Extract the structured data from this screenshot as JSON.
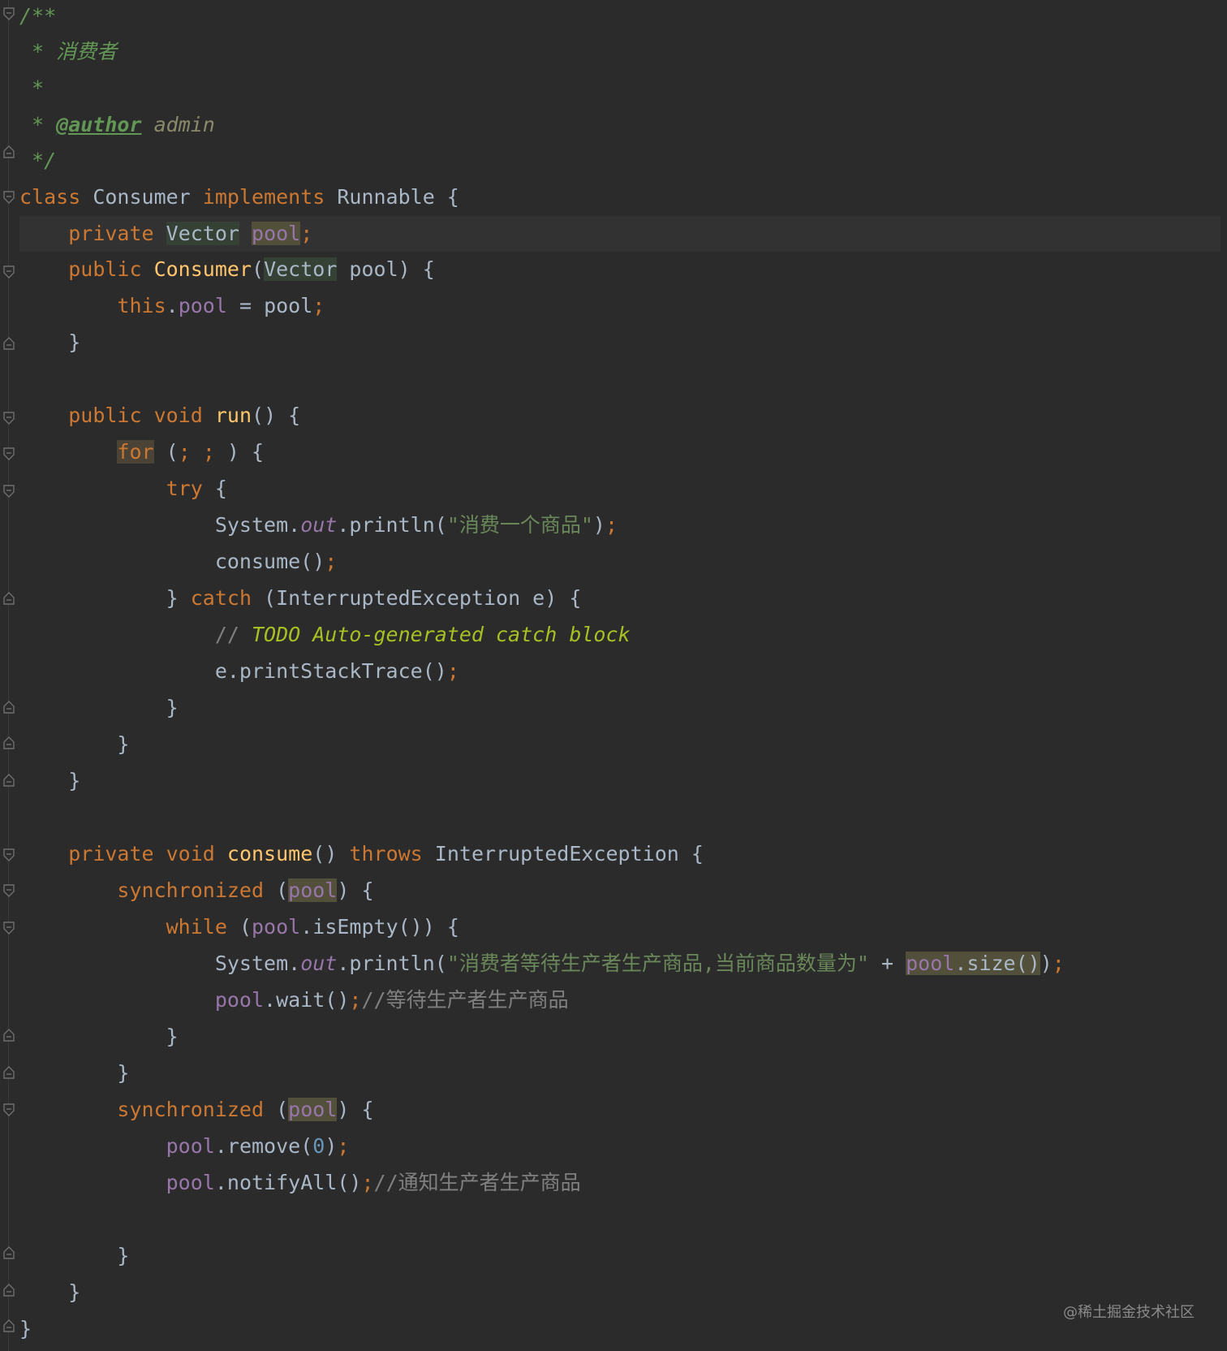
{
  "editor": {
    "doc": {
      "open": "/**",
      "line1": " * 消费者",
      "line2": " *",
      "line3_star": " * ",
      "author_tag": "@author",
      "author_name": " admin",
      "close": " */"
    },
    "class_decl": {
      "kw_class": "class",
      "name": " Consumer ",
      "kw_implements": "implements",
      "rest": " Runnable {"
    },
    "field": {
      "indent": "    ",
      "kw": "private",
      "sp": " ",
      "type": "Vector",
      "sp2": " ",
      "name": "pool",
      "semi": ";"
    },
    "ctor": {
      "indent": "    ",
      "kw": "public",
      "name": " Consumer",
      "paren": "(",
      "type": "Vector",
      "rest": " pool) {"
    },
    "ctor_body": {
      "indent": "        ",
      "this": "this",
      "dot": ".",
      "field": "pool",
      "rest": " = pool",
      "semi": ";"
    },
    "close4": "    }",
    "run": {
      "indent": "    ",
      "kw": "public void",
      "name": " run",
      "rest": "() {"
    },
    "for_line": {
      "indent": "        ",
      "kw": "for",
      "a": " (",
      "s1": ";",
      "b": " ",
      "s2": ";",
      "c": " ) {"
    },
    "try_line": {
      "indent": "            ",
      "kw": "try",
      "rest": " {"
    },
    "println1": {
      "indent": "                ",
      "a": "System.",
      "out": "out",
      "b": ".println(",
      "str": "\"消费一个商品\"",
      "c": ")",
      "semi": ";"
    },
    "consume_call": {
      "indent": "                ",
      "a": "consume()",
      "semi": ";"
    },
    "catch_line": {
      "indent": "            ",
      "a": "} ",
      "kw": "catch",
      "rest": " (InterruptedException e) {"
    },
    "todo_line": {
      "indent": "                ",
      "slashes": "// ",
      "todo": "TODO Auto-generated catch block"
    },
    "stack_line": {
      "indent": "                ",
      "a": "e.printStackTrace()",
      "semi": ";"
    },
    "close12": "            }",
    "close8": "        }",
    "consume_decl": {
      "indent": "    ",
      "kw": "private void",
      "name": " consume",
      "a": "() ",
      "kw2": "throws",
      "rest": " InterruptedException {"
    },
    "sync1": {
      "indent": "        ",
      "kw": "synchronized",
      "a": " (",
      "field": "pool",
      "rest": ") {"
    },
    "while_line": {
      "indent": "            ",
      "kw": "while",
      "a": " (",
      "field": "pool",
      "rest": ".isEmpty()) {"
    },
    "println2": {
      "indent": "                ",
      "a": "System.",
      "out": "out",
      "b": ".println(",
      "str": "\"消费者等待生产者生产商品,当前商品数量为\"",
      "c": " + ",
      "field": "pool",
      "d": ".size()",
      "e": ")",
      "semi": ";"
    },
    "wait_line": {
      "indent": "                ",
      "field": "pool",
      "a": ".wait()",
      "semi": ";",
      "cmt": "//等待生产者生产商品"
    },
    "sync2": {
      "indent": "        ",
      "kw": "synchronized",
      "a": " (",
      "field": "pool",
      "rest": ") {"
    },
    "remove_line": {
      "indent": "            ",
      "field": "pool",
      "a": ".remove(",
      "num": "0",
      "b": ")",
      "semi": ";"
    },
    "notify_line": {
      "indent": "            ",
      "field": "pool",
      "a": ".notifyAll()",
      "semi": ";",
      "cmt": "//通知生产者生产商品"
    },
    "close0": "}"
  },
  "watermark": "@稀土掘金技术社区",
  "colors": {
    "background": "#2b2b2b",
    "keyword": "#cc7832",
    "field": "#9876aa",
    "function": "#ffc66d",
    "string": "#6a8759",
    "number": "#6897bb",
    "comment": "#808080",
    "doc_comment": "#629755",
    "todo": "#a8c023",
    "text": "#a9b7c6"
  },
  "icons": [
    "fold-open-icon",
    "fold-close-icon"
  ]
}
